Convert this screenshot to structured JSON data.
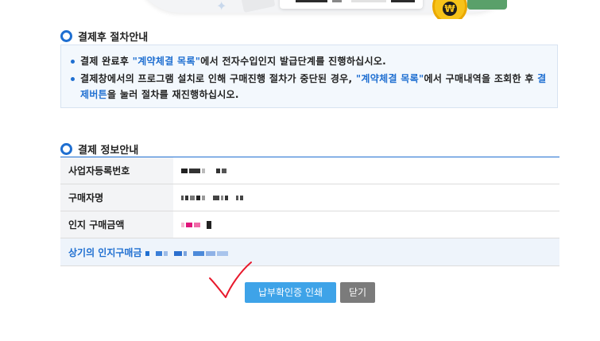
{
  "section1": {
    "title": "결제후 절차안내",
    "items": [
      {
        "pre": "결제 완료후 ",
        "link": "\"계약체결 목록\"",
        "post": "에서 전자수입인지 발급단계를 진행하십시오."
      },
      {
        "pre": "결제창에서의 프로그램 설치로 인해 구매진행 절차가 중단된 경우, ",
        "link": "\"계약체결 목록\"",
        "mid": "에서 구매내역을 조회한 후 ",
        "link2": "결제버튼",
        "post": "을 눌러 절차를 재진행하십시오."
      }
    ]
  },
  "section2": {
    "title": "결제 정보안내",
    "rows": [
      {
        "label": "사업자등록번호"
      },
      {
        "label": "구매자명"
      },
      {
        "label": "인지 구매금액"
      }
    ],
    "total_label": "상기의 인지구매금"
  },
  "buttons": {
    "print": "납부확인증 인쇄",
    "close": "닫기"
  },
  "colors": {
    "accent": "#1f6fd1",
    "print_button": "#3ea3e8",
    "close_button": "#7b7b7b",
    "annotation_check": "#e8192c"
  }
}
